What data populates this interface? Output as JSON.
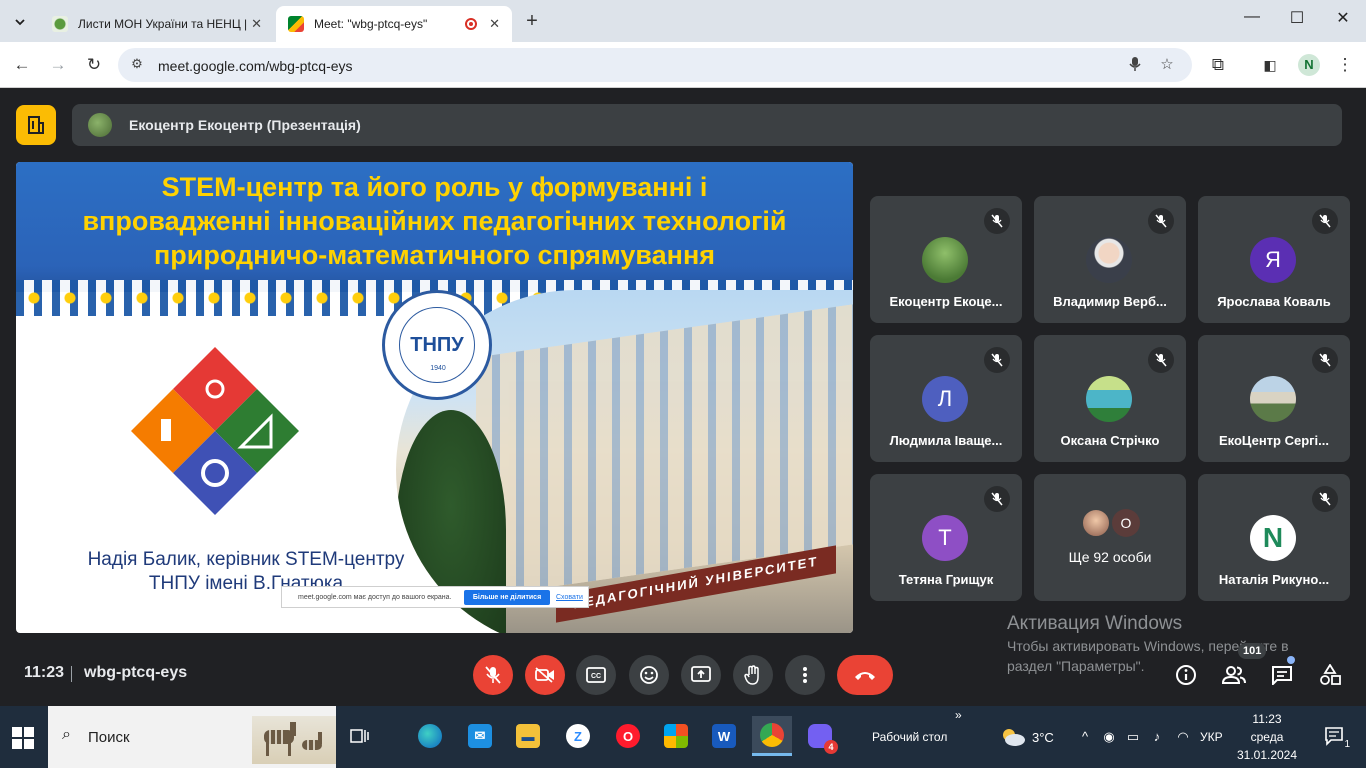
{
  "browser": {
    "tabs": [
      {
        "title": "Листи МОН України та НЕНЦ |",
        "active": false
      },
      {
        "title": "Meet: \"wbg-ptcq-eys\"",
        "active": true
      }
    ],
    "url": "meet.google.com/wbg-ptcq-eys",
    "profile_initial": "N"
  },
  "meet": {
    "presenter_bar": "Екоцентр Екоцентр (Презентація)",
    "slide": {
      "title_lines": [
        "STEM-центр та його роль у формуванні  і",
        "впровадженні інноваційних педагогічних технологій",
        "природничо-математичного спрямування"
      ],
      "emblem_abbr": "ТНПУ",
      "emblem_year": "1940",
      "building_sign": "ПЕДАГОГІЧНИЙ УНІВЕРСИТЕТ",
      "author_lines": [
        "Надія Балик, керівник STEM-центру",
        "ТНПУ імені В.Гнатюка"
      ],
      "share_notice": {
        "message": "meet.google.com має доступ до вашого екрана.",
        "stop_label": "Більше не ділитися",
        "hide_label": "Сховати"
      }
    },
    "participants": [
      {
        "name": "Екоцентр Екоце...",
        "avatar": "photo-green",
        "color": "#5f8f45"
      },
      {
        "name": "Владимир Верб...",
        "avatar": "photo-man",
        "color": "#d9d9d9"
      },
      {
        "name": "Ярослава Коваль",
        "avatar": "Я",
        "color": "#5b2fb3"
      },
      {
        "name": "Людмила Іваще...",
        "avatar": "Л",
        "color": "#4e5fbf"
      },
      {
        "name": "Оксана Стрічко",
        "avatar": "photo-river",
        "color": "#4cb5c8"
      },
      {
        "name": "ЕкоЦентр Сергі...",
        "avatar": "photo-building",
        "color": "#6a8a5a"
      },
      {
        "name": "Тетяна Грищук",
        "avatar": "Т",
        "color": "#8e4fc5"
      },
      {
        "name": "Наталія Рикуно...",
        "avatar": "N",
        "color": "#ffffff"
      }
    ],
    "more_people": {
      "label": "Ще 92 особи",
      "avatar_letter": "O"
    },
    "activation": {
      "title": "Активация Windows",
      "text": "Чтобы активировать Windows, перейдите в раздел \"Параметры\"."
    },
    "bottom": {
      "time": "11:23",
      "meeting_code": "wbg-ptcq-eys",
      "people_count": "101"
    }
  },
  "taskbar": {
    "search_label": "Поиск",
    "desktop_label": "Рабочий стол",
    "temperature": "3°C",
    "language": "УКР",
    "time": "11:23",
    "weekday": "среда",
    "date": "31.01.2024",
    "notifications": "1",
    "viber_badge": "4",
    "chevron": "»"
  },
  "colors": {
    "meet_bg": "#202124",
    "tile_bg": "#3c4043",
    "end_call": "#ea4335",
    "slide_title": "#ffd200",
    "taskbar": "#1f2d3d"
  }
}
